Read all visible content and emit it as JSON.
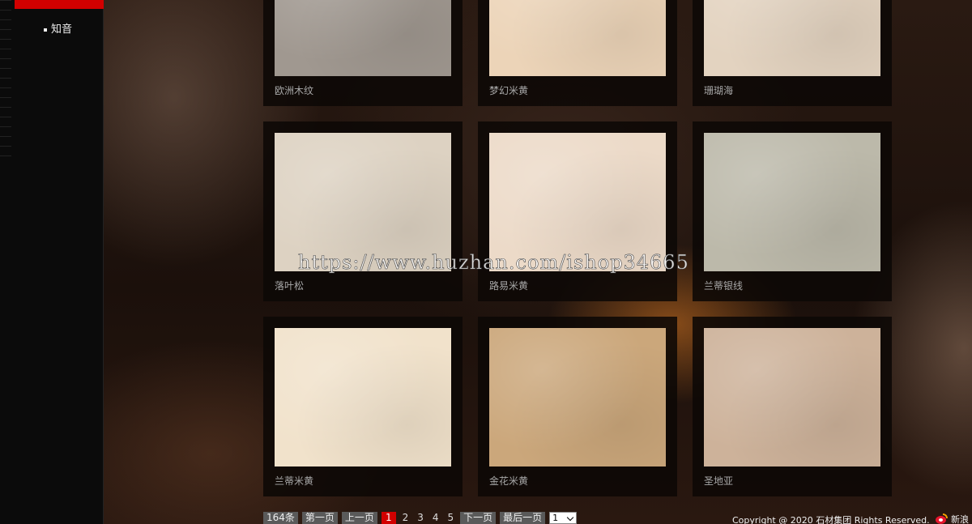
{
  "sidebar": {
    "nav_item": "知音"
  },
  "products": [
    {
      "name": "欧洲木纹",
      "color": "#a09890"
    },
    {
      "name": "梦幻米黄",
      "color": "#ecd4b8"
    },
    {
      "name": "珊瑚海",
      "color": "#e3d3c0"
    },
    {
      "name": "落叶松",
      "color": "#ddd2c2"
    },
    {
      "name": "路易米黄",
      "color": "#ecdac8"
    },
    {
      "name": "兰蒂银线",
      "color": "#bcb9aa"
    },
    {
      "name": "兰蒂米黄",
      "color": "#f1e2cb"
    },
    {
      "name": "金花米黄",
      "color": "#cba77b"
    },
    {
      "name": "圣地亚",
      "color": "#cdb29a"
    }
  ],
  "pagination": {
    "total": "164条",
    "first": "第一页",
    "prev": "上一页",
    "pages": [
      "1",
      "2",
      "3",
      "4",
      "5"
    ],
    "active_page": "1",
    "next": "下一页",
    "last": "最后一页",
    "select_value": "1"
  },
  "footer": {
    "copyright": "Copyright @ 2020 石材集团 Rights Reserved.",
    "weibo_label": "新浪"
  },
  "watermark": "https://www.huzhan.com/ishop34665",
  "colors": {
    "accent_red": "#d20000",
    "sidebar_bg": "#0b0b0b"
  }
}
